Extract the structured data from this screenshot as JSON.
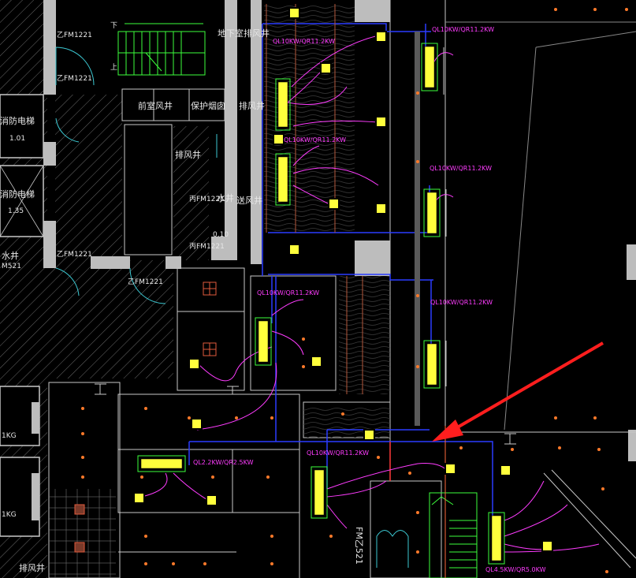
{
  "labels": {
    "fm1221_a": "乙FM1221",
    "fm1221_b": "乙FM1221",
    "fm1221_c": "乙FM1221",
    "fm1221_d": "乙FM1221",
    "down": "下",
    "up": "上",
    "basement_exhaust_shaft": "地下室排风井",
    "front_room_fan_shaft": "前室风井",
    "protected_flue": "保护烟囱",
    "exhaust_shaft_1": "排风井",
    "exhaust_shaft_2": "排风井",
    "exhaust_shaft_3": "排风井",
    "supply_shaft": "送风井",
    "water_shaft": "水井",
    "water_well_left": "水井",
    "pipe_shaft_1": "丙FM1221",
    "pipe_shaft_2": "丙FM1221",
    "elevator_1": "消防电梯",
    "elevator_2": "消防电梯",
    "door_fmz521": "FM乙521",
    "misc_1": "1.01",
    "misc_2": "1.35",
    "misc_3": "0.10",
    "misc_4": "M521",
    "misc_5": "1KG",
    "misc_6": "1KG"
  },
  "units": [
    {
      "id": "u1",
      "label": "QL10KW/QR11.2KW"
    },
    {
      "id": "u2",
      "label": "QL10KW/QR11.2KW"
    },
    {
      "id": "u3",
      "label": "QL10KW/QR11.2KW"
    },
    {
      "id": "u4",
      "label": "QL10KW/QR11.2KW"
    },
    {
      "id": "u5",
      "label": "QL10KW/QR11.2KW"
    },
    {
      "id": "u6",
      "label": "QL10KW/QR11.2KW"
    },
    {
      "id": "u7",
      "label": "QL10KW/QR11.2KW"
    },
    {
      "id": "u8",
      "label": "QL2.2KW/QR2.5KW"
    },
    {
      "id": "u9",
      "label": "QL4.5KW/QR5.0KW"
    }
  ],
  "colors": {
    "background": "#000000",
    "wall": "#c8c8c8",
    "duct": "#2b3cff",
    "unit": "#ffff3c",
    "unit_outline": "#3cff3c",
    "branch": "#ff3cff",
    "pipe": "#e05a3c",
    "annotation_arrow": "#ff1e1e",
    "stair": "#3cff3c",
    "door": "#3cc8d2"
  },
  "annotation_arrow": {
    "icon": "red-arrow-icon"
  }
}
